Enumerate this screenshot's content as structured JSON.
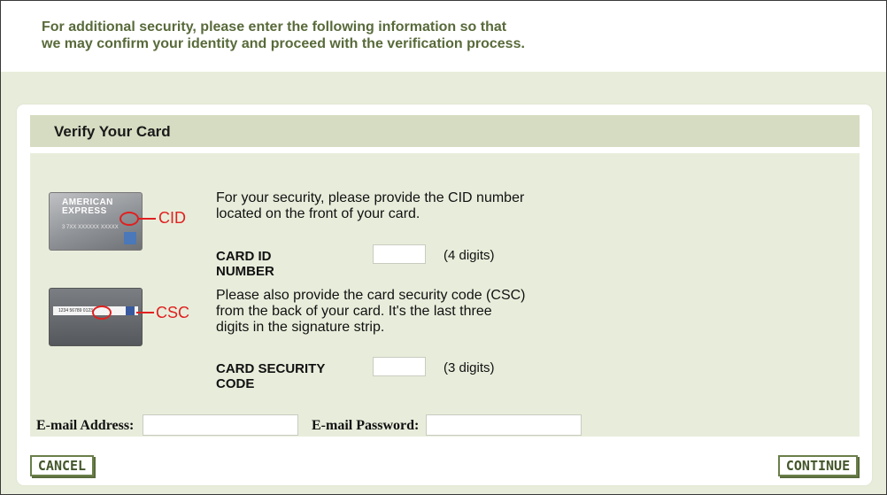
{
  "intro": {
    "line1": "For additional security, please enter the following information so that",
    "line2": "we may confirm your identity and proceed with the verification process."
  },
  "card": {
    "title": "Verify Your Card",
    "cid_paragraph_line1": "For your security, please provide the CID number",
    "cid_paragraph_line2": "located on the front of your card.",
    "cid_label_line1": "CARD ID",
    "cid_label_line2": "NUMBER",
    "cid_hint": "(4 digits)",
    "csc_paragraph_line1": "Please also provide the card security code (CSC)",
    "csc_paragraph_line2": "from the back of your card. It's the last three",
    "csc_paragraph_line3": "digits in the signature strip.",
    "csc_label_line1": "CARD SECURITY",
    "csc_label_line2": "CODE",
    "csc_hint": "(3 digits)",
    "cid_callout": "CID",
    "csc_callout": "CSC",
    "amex_line1": "AMERICAN",
    "amex_line2": "EXPRESS"
  },
  "email": {
    "address_label": "E-mail Address:",
    "password_label": "E-mail Password:",
    "address_value": "",
    "password_value": ""
  },
  "buttons": {
    "cancel": "CANCEL",
    "continue": "CONTINUE"
  },
  "colors": {
    "accent_green": "#586a3a",
    "panel_header": "#d6dcc1",
    "panel_body": "#e8eddb",
    "callout_red": "#e02020"
  }
}
